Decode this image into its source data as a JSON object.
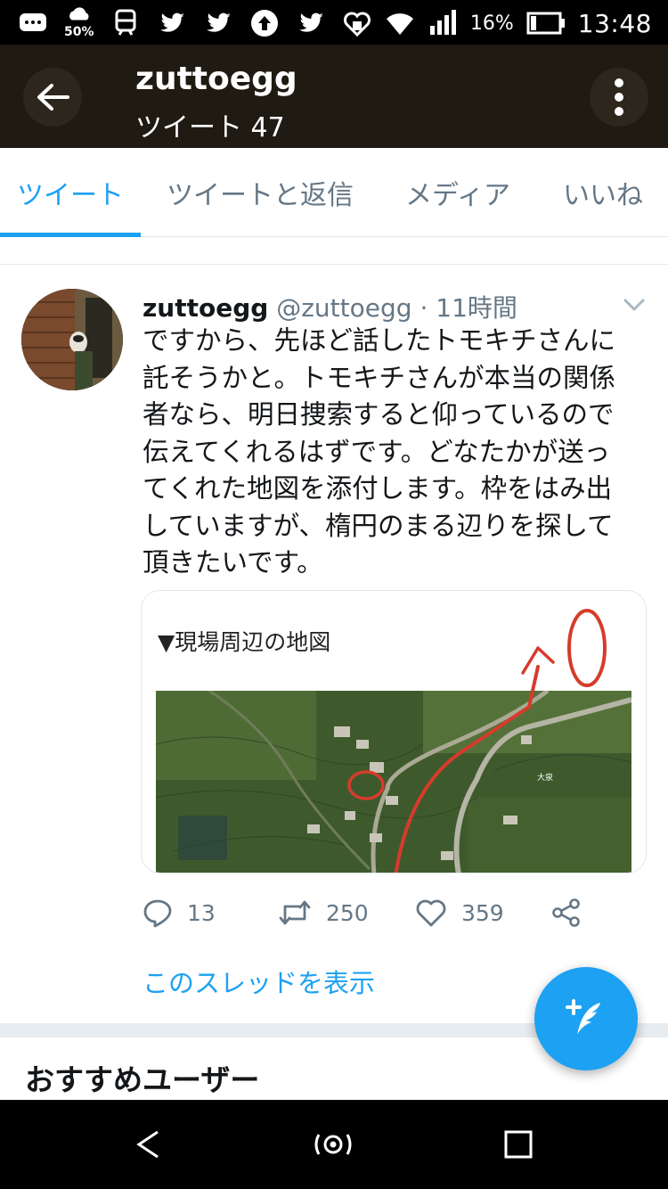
{
  "status_bar": {
    "left_icons": [
      "message-icon",
      "weather-icon",
      "train-icon",
      "twitter-icon",
      "twitter-icon",
      "upload-icon",
      "twitter-icon"
    ],
    "weather_percent": "50%",
    "battery_percent": "16%",
    "time": "13:48"
  },
  "app_bar": {
    "title": "zuttoegg",
    "subtitle": "ツイート 47"
  },
  "tabs": [
    {
      "label": "ツイート",
      "active": true
    },
    {
      "label": "ツイートと返信",
      "active": false
    },
    {
      "label": "メディア",
      "active": false
    },
    {
      "label": "いいね",
      "active": false
    }
  ],
  "tweet": {
    "name": "zuttoegg",
    "handle": "@zuttoegg",
    "separator": "·",
    "time": "11時間",
    "lines": [
      "ですから、先ほど話したトモキチさんに",
      "託そうかと。トモキチさんが本当の関係",
      "者なら、明日捜索すると仰っているので",
      "伝えてくれるはずです。どなたかが送っ",
      "てくれた地図を添付します。枠をはみ出",
      "していますが、楕円のまる辺りを探して",
      "頂きたいです。"
    ],
    "card_caption": "▼現場周辺の地図",
    "map_label": "大泉",
    "replies": "13",
    "retweets": "250",
    "likes": "359",
    "thread_link": "このスレッドを表示"
  },
  "section": {
    "title": "おすすめユーザー"
  },
  "colors": {
    "accent": "#1da1f2",
    "app_bar_bg": "#1f1a12",
    "annotation_red": "#d63b2c"
  }
}
